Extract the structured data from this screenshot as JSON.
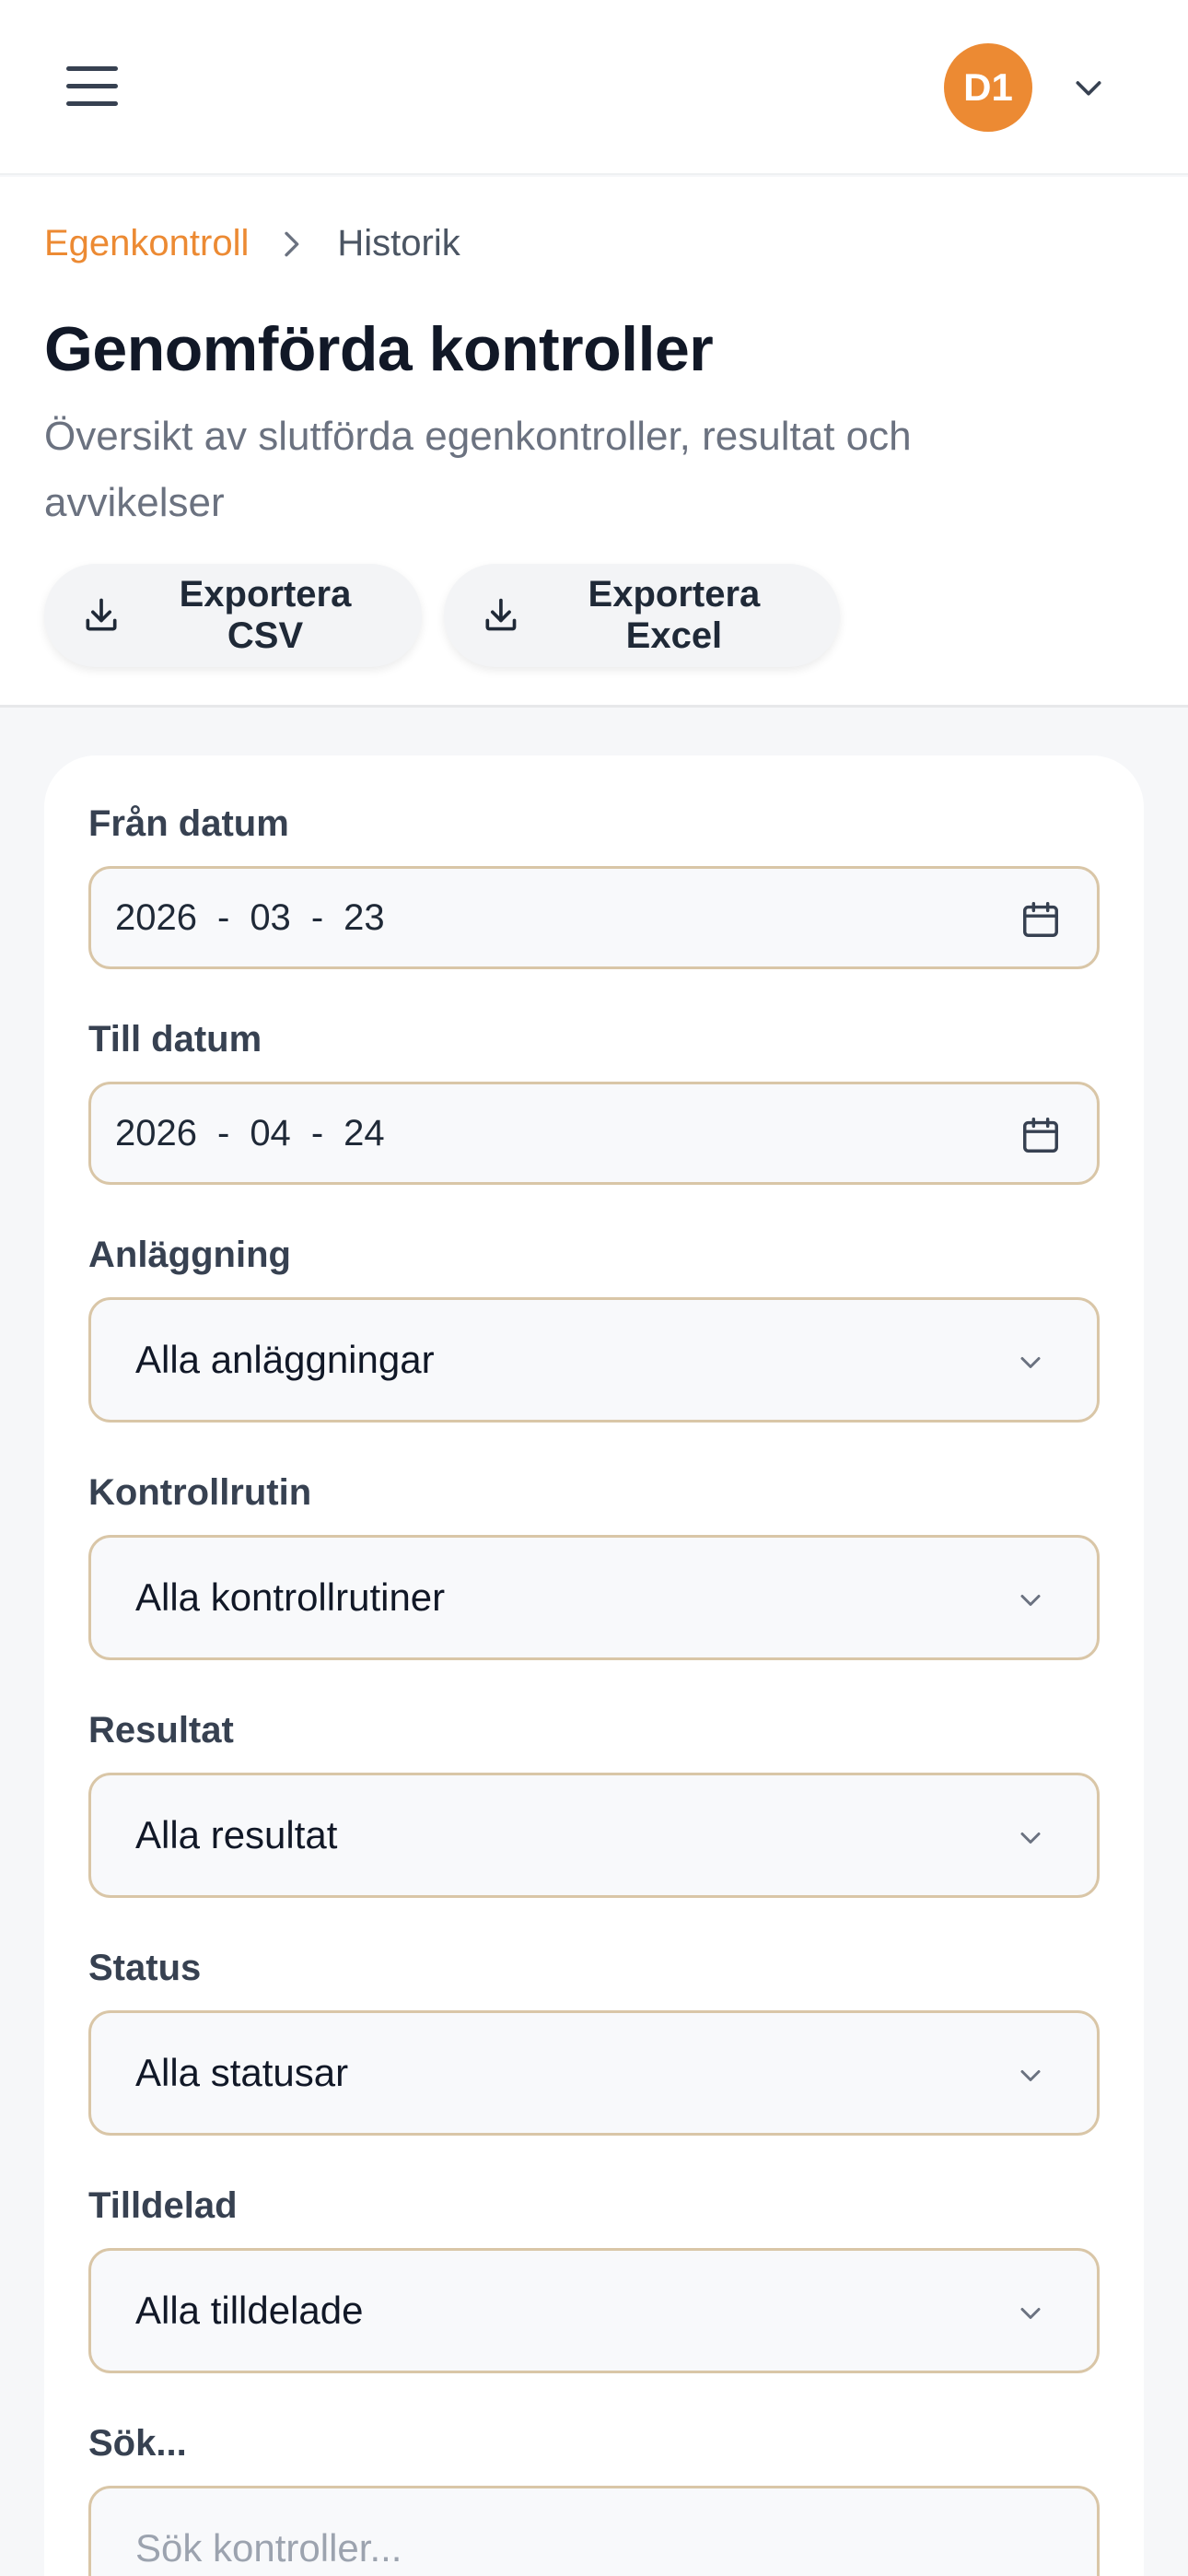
{
  "topbar": {
    "avatar_initials": "D1",
    "menu_icon": "hamburger-menu-icon",
    "user_menu_icon": "chevron-down-icon"
  },
  "breadcrumb": {
    "parent": "Egenkontroll",
    "current": "Historik",
    "separator_icon": "chevron-right-icon"
  },
  "page": {
    "title": "Genomförda kontroller",
    "subtitle": "Översikt av slutförda egenkontroller, resultat och avvikelser"
  },
  "actions": {
    "export_csv": "Exportera CSV",
    "export_excel": "Exportera Excel",
    "icon": "download-icon"
  },
  "filters": {
    "from_date": {
      "label": "Från datum",
      "year": "2026",
      "month": "03",
      "day": "23",
      "icon": "calendar-icon"
    },
    "to_date": {
      "label": "Till datum",
      "year": "2026",
      "month": "04",
      "day": "24",
      "icon": "calendar-icon"
    },
    "facility": {
      "label": "Anläggning",
      "value": "Alla anläggningar"
    },
    "routine": {
      "label": "Kontrollrutin",
      "value": "Alla kontrollrutiner"
    },
    "result": {
      "label": "Resultat",
      "value": "Alla resultat"
    },
    "status": {
      "label": "Status",
      "value": "Alla statusar"
    },
    "assigned": {
      "label": "Tilldelad",
      "value": "Alla tilldelade"
    },
    "search": {
      "label": "Sök...",
      "placeholder": "Sök kontroller..."
    }
  },
  "colors": {
    "accent": "#ec8a33",
    "input_border": "#d9c6a7",
    "page_background": "#f6f7f9"
  }
}
